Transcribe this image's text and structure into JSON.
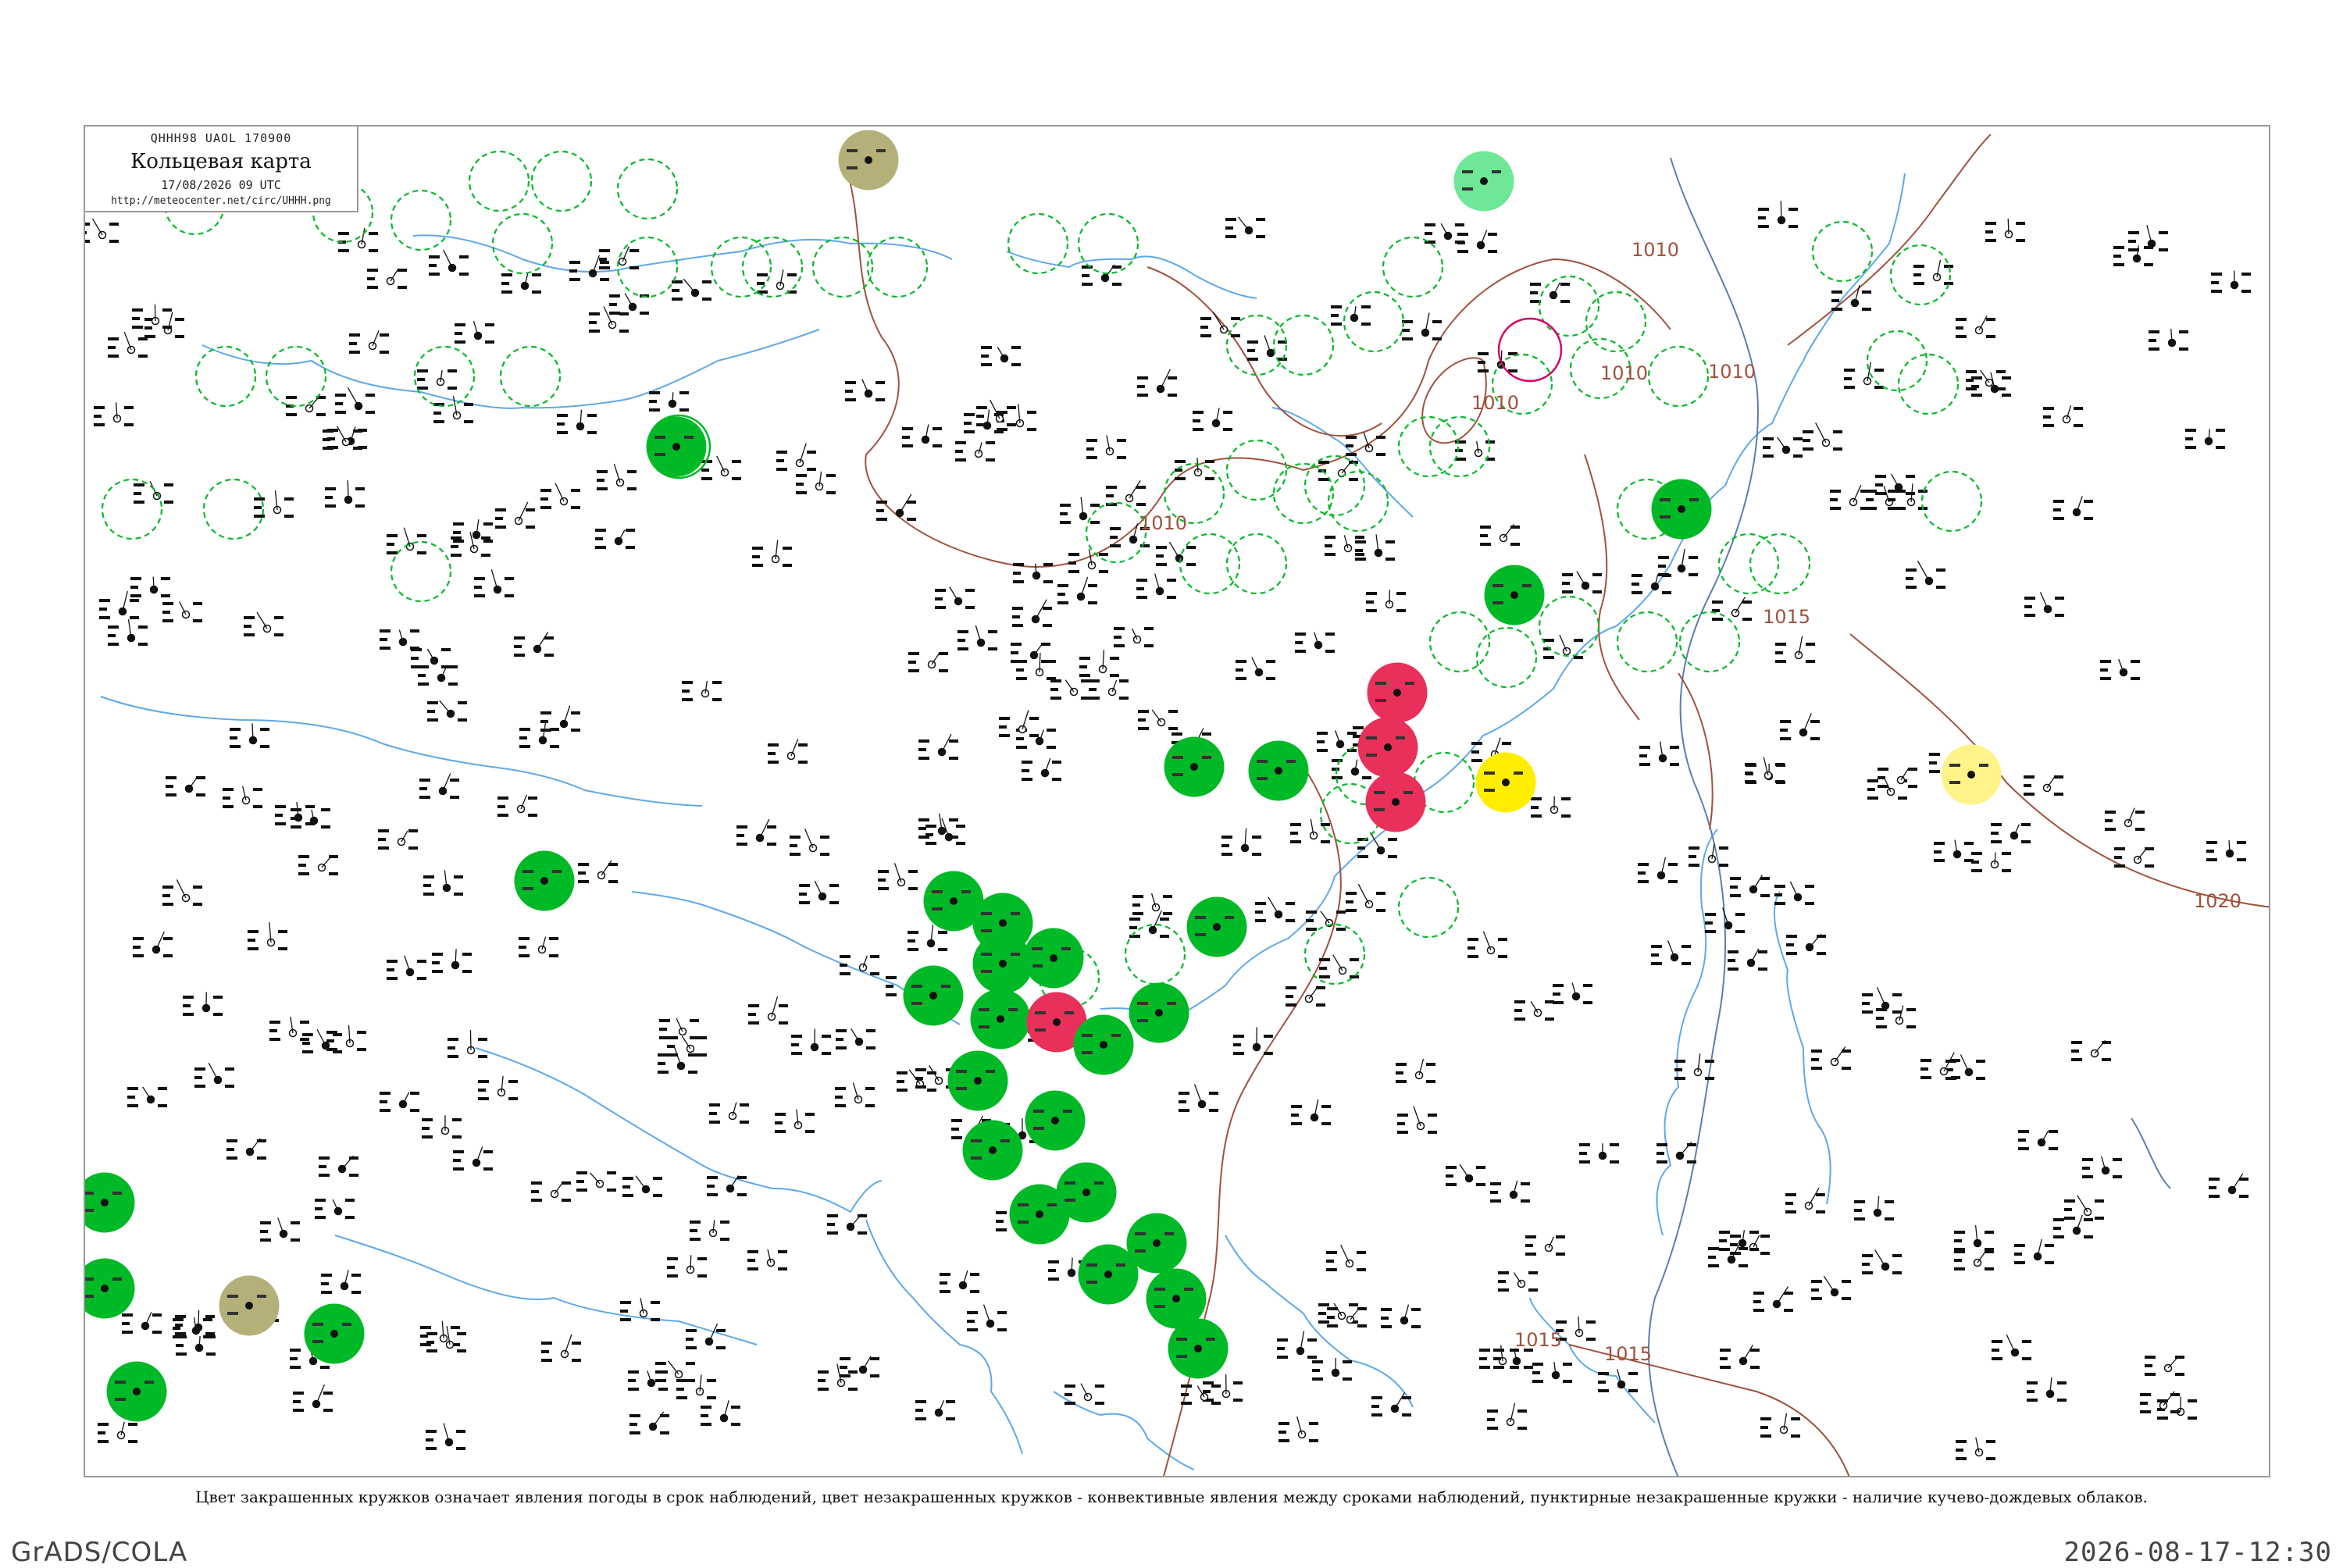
{
  "title_box": {
    "code": "QHHH98  UAOL  170900",
    "title": "Кольцевая карта",
    "date": "17/08/2026 09 UTC",
    "url": "http://meteocenter.net/circ/UHHH.png"
  },
  "caption": "Цвет закрашенных кружков означает явления погоды в срок наблюдений, цвет незакрашенных кружков - конвективные явления между сроками наблюдений, пунктирные незакрашенные кружки - наличие кучево-дождевых облаков.",
  "footer": {
    "left": "GrADS/COLA",
    "right": "2026-08-17-12:30"
  },
  "isobar_labels": [
    "1010",
    "1010",
    "1010",
    "1010",
    "1010",
    "1015",
    "1015",
    "1020",
    "1015"
  ],
  "colors": {
    "rain_fill": "#00b926",
    "thunder_fill": "#e8305a",
    "fog_fill": "#b5b07a",
    "haze_fill": "#ffee00",
    "light_fill": "#6ee896",
    "pale_yellow_fill": "#fff38a",
    "cb_ring": "#00b926",
    "storm_ring": "#d4006a",
    "isobar": "#a0523c",
    "river": "#5fa8e8"
  },
  "station_legend": {
    "filled_green": "rain",
    "filled_red": "thunderstorm",
    "filled_olive": "fog",
    "filled_yellow": "haze",
    "dashed_green_ring": "cumulonimbus"
  }
}
